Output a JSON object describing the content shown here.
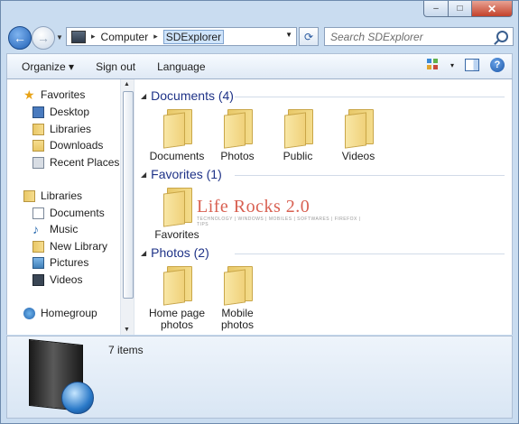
{
  "window": {
    "caption": {
      "minimize_glyph": "–",
      "maximize_glyph": "□",
      "close_glyph": "✕"
    }
  },
  "address_bar": {
    "breadcrumbs": [
      "Computer",
      "SDExplorer"
    ],
    "separator": "▸",
    "search_placeholder": "Search SDExplorer"
  },
  "toolbar": {
    "items": [
      "Organize ▾",
      "Sign out",
      "Language"
    ],
    "views_chevron": "▾",
    "help_glyph": "?"
  },
  "nav_pane": {
    "favorites": {
      "label": "Favorites",
      "items": [
        "Desktop",
        "Libraries",
        "Downloads",
        "Recent Places"
      ]
    },
    "libraries": {
      "label": "Libraries",
      "items": [
        "Documents",
        "Music",
        "New Library",
        "Pictures",
        "Videos"
      ]
    },
    "homegroup": {
      "label": "Homegroup"
    }
  },
  "groups": [
    {
      "header": "Documents (4)",
      "items": [
        "Documents",
        "Photos",
        "Public",
        "Videos"
      ]
    },
    {
      "header": "Favorites (1)",
      "items": [
        "Favorites"
      ]
    },
    {
      "header": "Photos (2)",
      "items": [
        "Home page photos",
        "Mobile photos"
      ]
    }
  ],
  "watermark": {
    "title": "Life Rocks 2.0",
    "subtitle": "TECHNOLOGY | WINDOWS | MOBILES | SOFTWARES | FIREFOX | TIPS"
  },
  "details": {
    "item_count": "7 items"
  },
  "colors": {
    "group_header": "#1e3287",
    "window_frame": "#c9dcf0",
    "accent_blue": "#1f5fb4"
  }
}
